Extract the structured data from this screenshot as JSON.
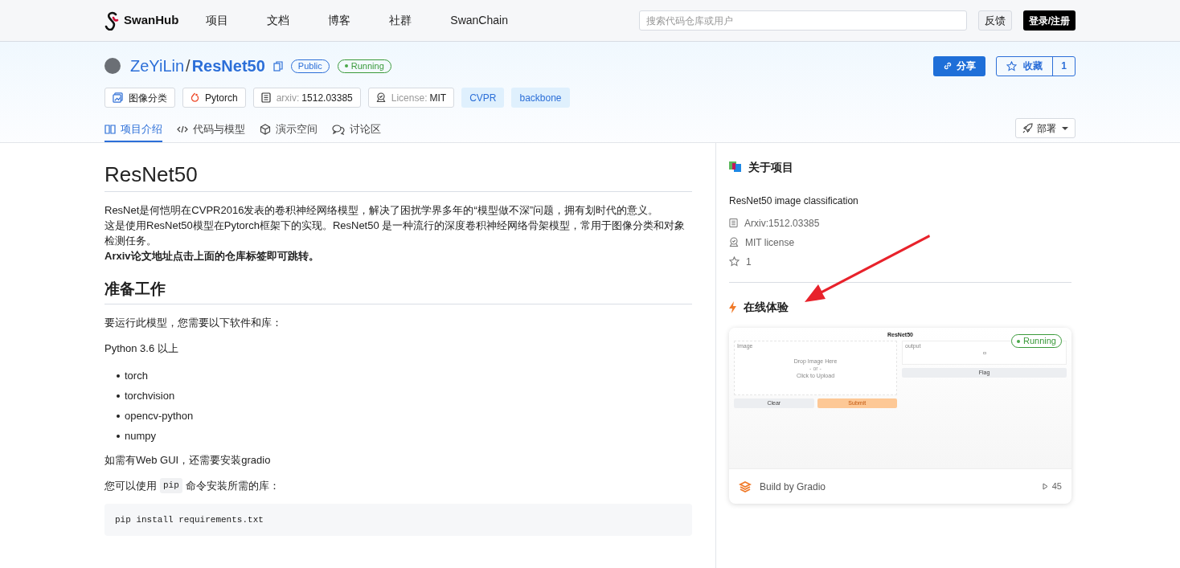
{
  "nav": {
    "brand": "SwanHub",
    "links": [
      "项目",
      "文档",
      "博客",
      "社群",
      "SwanChain"
    ],
    "search": {
      "placeholder": "搜索代码仓库或用户"
    },
    "feedback": "反馈",
    "login": "登录/注册"
  },
  "repo": {
    "owner": "ZeYiLin",
    "separator": "/",
    "name": "ResNet50",
    "visibility": "Public",
    "status": "Running",
    "share": "分享",
    "star": "收藏",
    "star_count": "1",
    "tags": [
      {
        "kind": "task",
        "text": "图像分类"
      },
      {
        "kind": "framework",
        "text": "Pytorch"
      },
      {
        "kind": "arxiv",
        "label": "arxiv:",
        "text": "1512.03385"
      },
      {
        "kind": "license",
        "label": "License:",
        "text": "MIT"
      },
      {
        "kind": "topic",
        "text": "CVPR"
      },
      {
        "kind": "topic",
        "text": "backbone"
      }
    ],
    "tabs": [
      {
        "kind": "book",
        "label": "项目介绍",
        "selected": true
      },
      {
        "kind": "code",
        "label": "代码与模型",
        "selected": false
      },
      {
        "kind": "cube",
        "label": "演示空间",
        "selected": false
      },
      {
        "kind": "chat",
        "label": "讨论区",
        "selected": false
      }
    ],
    "deploy": "部署"
  },
  "readme": {
    "title": "ResNet50",
    "intro": [
      "ResNet是何恺明在CVPR2016发表的卷积神经网络模型，解决了困扰学界多年的“模型做不深”问题，拥有划时代的意义。",
      "这是使用ResNet50模型在Pytorch框架下的实现。ResNet50 是一种流行的深度卷积神经网络骨架模型，常用于图像分类和对象检测任务。"
    ],
    "intro_bold": "Arxiv论文地址点击上面的仓库标签即可跳转。",
    "section": "准备工作",
    "requirement": "要运行此模型，您需要以下软件和库：",
    "python": "Python 3.6 以上",
    "packages": [
      "torch",
      "torchvision",
      "opencv-python",
      "numpy"
    ],
    "gui_note": "如需有Web GUI，还需要安装gradio",
    "pip_before": "您可以使用",
    "pip_code": "pip",
    "pip_after": "命令安装所需的库：",
    "command": "pip install requirements.txt"
  },
  "about": {
    "title": "关于项目",
    "description": "ResNet50 image classification",
    "facts": [
      {
        "kind": "paper",
        "text": "Arxiv:1512.03385"
      },
      {
        "kind": "license",
        "text": "MIT license"
      },
      {
        "kind": "star",
        "text": "1"
      }
    ]
  },
  "demo": {
    "title": "在线体验",
    "preview": {
      "title": "ResNet50",
      "input_label": "Image",
      "drop": "Drop Image Here",
      "or": "- or -",
      "upload": "Click to Upload",
      "clear": "Clear",
      "submit": "Submit",
      "output_label": "output",
      "flag": "Flag"
    },
    "status": "Running",
    "footer": "Build by Gradio",
    "plays": "45"
  }
}
